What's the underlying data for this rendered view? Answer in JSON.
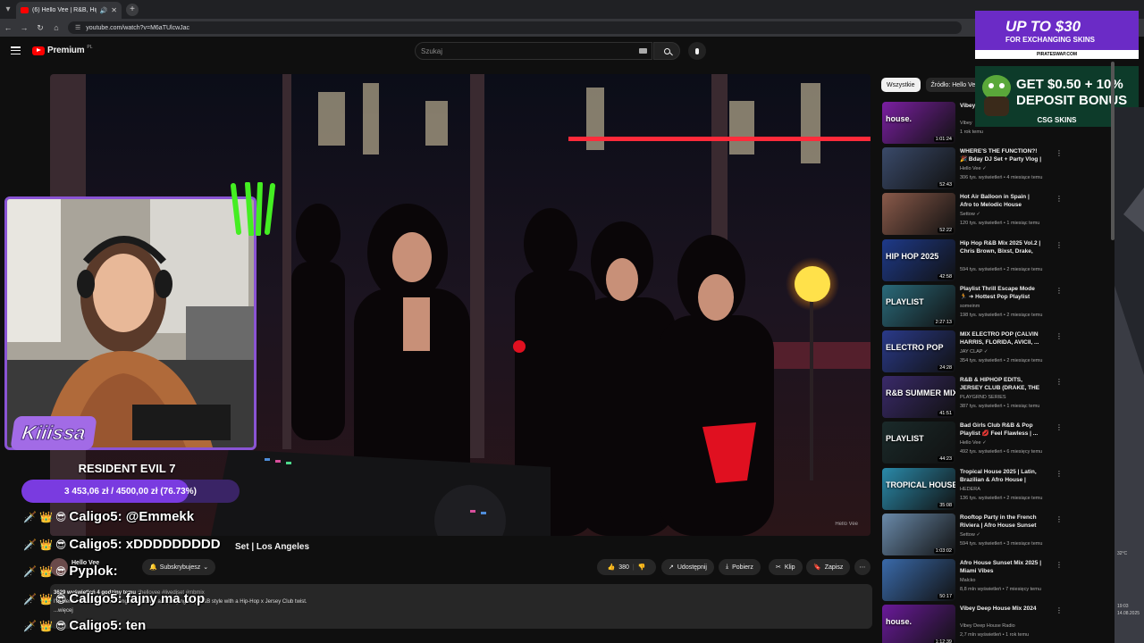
{
  "browser": {
    "tab_title": "(6) Hello Vee | R&B, Hip-H",
    "url": "youtube.com/watch?v=M6aTUlcwJac"
  },
  "header": {
    "logo_text": "Premium",
    "logo_country": "PL",
    "search_placeholder": "Szukaj"
  },
  "overlay": {
    "brand": "Kiiissa",
    "goal_title": "RESIDENT EVIL 7",
    "goal_text": "3 453,06 zł / 4500,00 zł (76.73%)",
    "goal_fraction": 0.7673,
    "chat": [
      "Caligo5: @Emmekk",
      "Caligo5: xDDDDDDDDD",
      "Pyplok:",
      "Caligo5: fajny ma top",
      "Caligo5: ten"
    ],
    "colors": {
      "accent": "#8a54d4",
      "goal_fill": "#7a3be0"
    }
  },
  "video": {
    "title_visible": "Set | Los Angeles",
    "watermark": "Hello Vee",
    "channel_name": "Hello Vee",
    "subscribe_label": "Subskrybujesz",
    "likes": "380",
    "share_label": "Udostępnij",
    "download_label": "Pobierz",
    "clip_label": "Klip",
    "save_label": "Zapisz",
    "desc_meta": "3629 wyświetleń  4 godziny temu",
    "desc_tags": "#hellovee #livedjset #mbmix",
    "desc_text": "I'm Hello Vee live from Los Angeles and we are partying it up R&B style with  a Hip-Hop x Jersey Club twist.",
    "desc_more": "...więcej"
  },
  "sidebar": {
    "chips": [
      "Wszystkie",
      "Źródło: Hello Vee"
    ],
    "items": [
      {
        "title": "Vibey Yama",
        "channel": "Vibey",
        "meta": "1 rok temu",
        "duration": "1:01:24",
        "thumb": "house.",
        "color": "#7b1fa2"
      },
      {
        "title": "WHERE'S THE FUNCTION?! 🎉 Bday DJ Set + Party Vlog | ...",
        "channel": "Hello Vee ✓",
        "meta": "306 tys. wyświetleń • 4 miesiące temu",
        "duration": "52:43",
        "thumb": "",
        "color": "#3a4a6a"
      },
      {
        "title": "Hot Air Balloon in Spain | Afro to Melodic House Sunrise Mix ...",
        "channel": "Settow ✓",
        "meta": "120 tys. wyświetleń • 1 miesiąc temu",
        "duration": "52:22",
        "thumb": "",
        "color": "#8a5a4a"
      },
      {
        "title": "Hip Hop R&B Mix 2025 Vol.2 | Chris Brown, Bixst, Drake, Doja...",
        "channel": "",
        "meta": "594 tys. wyświetleń • 2 miesiące temu",
        "duration": "42:58",
        "thumb": "HIP HOP 2025",
        "color": "#1e3a8a"
      },
      {
        "title": "Playlist Thrill Escape Mode 🏃 ➜ Hottest Pop Playlist right ...",
        "channel": "someinm",
        "meta": "198 tys. wyświetleń • 2 miesiące temu",
        "duration": "2:27:13",
        "thumb": "PLAYLIST",
        "color": "#2a6a7a"
      },
      {
        "title": "MIX ELECTRO POP (CALVIN HARRIS, FLORIDA, AVICII, ...",
        "channel": "JAY CLAP ✓",
        "meta": "354 tys. wyświetleń • 2 miesiące temu",
        "duration": "24:28",
        "thumb": "ELECTRO POP",
        "color": "#2a3a8a"
      },
      {
        "title": "R&B & HIPHOP EDITS, JERSEY CLUB (DRAKE, THE WEEKND, ...",
        "channel": "PLAYGRND SERIES",
        "meta": "387 tys. wyświetleń • 1 miesiąc temu",
        "duration": "41:51",
        "thumb": "R&B SUMMER MIX",
        "color": "#3a2a6a"
      },
      {
        "title": "Bad Girls Club R&B & Pop Playlist 💋 Feel Flawless | ...",
        "channel": "Hello Vee ✓",
        "meta": "492 tys. wyświetleń • 6 miesięcy temu",
        "duration": "44:23",
        "thumb": "PLAYLIST",
        "color": "#1a2a2a"
      },
      {
        "title": "Tropical House 2025 | Latin, Brazilian & Afro House | Adam ...",
        "channel": "HEDERA",
        "meta": "136 tys. wyświetleń • 2 miesiące temu",
        "duration": "35:08",
        "thumb": "TROPICAL HOUSE",
        "color": "#2a8aaa"
      },
      {
        "title": "Rooftop Party in the French Riviera | Afro House Sunset Mi...",
        "channel": "Settow ✓",
        "meta": "594 tys. wyświetleń • 3 miesiące temu",
        "duration": "1:03:02",
        "thumb": "",
        "color": "#6a8aaa"
      },
      {
        "title": "Afro House Sunset Mix 2025 | Miami Vibes",
        "channel": "Malcko",
        "meta": "8,8 mln wyświetleń • 7 miesięcy temu",
        "duration": "50:17",
        "thumb": "",
        "color": "#3a6aaa"
      },
      {
        "title": "Vibey Deep House Mix 2024",
        "channel": "Vibey Deep House Radio",
        "meta": "2,7 mln wyświetleń • 1 rok temu",
        "duration": "1:12:39",
        "thumb": "house.",
        "color": "#6a1a9a"
      }
    ]
  },
  "ads": {
    "ad1_big": "UP TO $30",
    "ad1_small": "FOR EXCHANGING SKINS",
    "ad1_foot": "PIRATESWAP.COM",
    "ad2_line1": "GET $0.50 + 10%",
    "ad2_line2": "DEPOSIT BONUS",
    "ad2_brand": "CSG SKINS"
  },
  "desktop": {
    "temp": "32°C",
    "time": "19:03",
    "date": "14.08.2025"
  }
}
